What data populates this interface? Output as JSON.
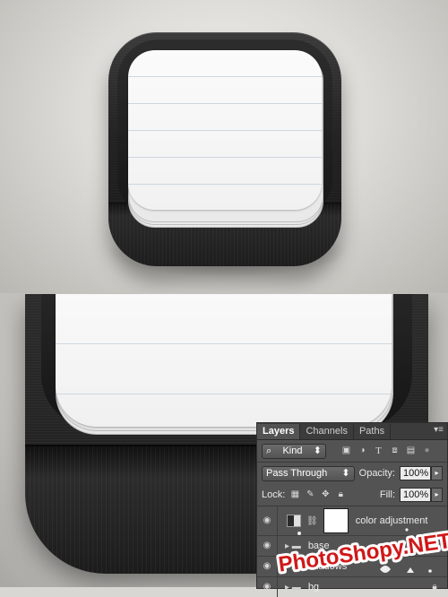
{
  "layers_panel": {
    "tabs": [
      "Layers",
      "Channels",
      "Paths"
    ],
    "filter_kind": "Kind",
    "filter_icons": [
      "image-filter-icon",
      "adjustment-filter-icon",
      "type-filter-icon",
      "shape-filter-icon",
      "smart-object-filter-icon"
    ],
    "blend_mode": "Pass Through",
    "opacity_label": "Opacity:",
    "opacity_value": "100%",
    "lock_label": "Lock:",
    "fill_label": "Fill:",
    "fill_value": "100%",
    "layers": [
      {
        "name": "color adjustment"
      },
      {
        "name": "base"
      },
      {
        "name": "shadows"
      },
      {
        "name": "bg"
      }
    ]
  },
  "watermark": {
    "text": "PhotoShopy.NET"
  },
  "colors": {
    "panel_bg": "#535353",
    "icon_dark": "#1d1d1d",
    "paper": "#f4f4f4",
    "ruled_line": "#cfd6e2",
    "watermark_red": "#d01818"
  }
}
